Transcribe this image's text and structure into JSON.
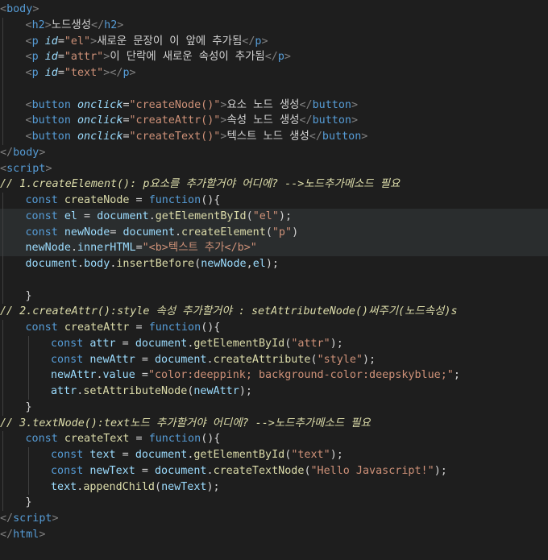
{
  "editor": {
    "lines": [
      {
        "indent": 0,
        "tokens": [
          [
            "br",
            "<"
          ],
          [
            "tag",
            "body"
          ],
          [
            "br",
            ">"
          ]
        ]
      },
      {
        "indent": 1,
        "tokens": [
          [
            "br",
            "<"
          ],
          [
            "tag",
            "h2"
          ],
          [
            "br",
            ">"
          ],
          [
            "t",
            "노드생성"
          ],
          [
            "br",
            "</"
          ],
          [
            "tag",
            "h2"
          ],
          [
            "br",
            ">"
          ]
        ]
      },
      {
        "indent": 1,
        "tokens": [
          [
            "br",
            "<"
          ],
          [
            "tag",
            "p"
          ],
          [
            "t",
            " "
          ],
          [
            "attr",
            "id"
          ],
          [
            "p",
            "="
          ],
          [
            "str",
            "\"el\""
          ],
          [
            "br",
            ">"
          ],
          [
            "t",
            "새로운 문장이 이 앞에 추가됨"
          ],
          [
            "br",
            "</"
          ],
          [
            "tag",
            "p"
          ],
          [
            "br",
            ">"
          ]
        ]
      },
      {
        "indent": 1,
        "tokens": [
          [
            "br",
            "<"
          ],
          [
            "tag",
            "p"
          ],
          [
            "t",
            " "
          ],
          [
            "attr",
            "id"
          ],
          [
            "p",
            "="
          ],
          [
            "str",
            "\"attr\""
          ],
          [
            "br",
            ">"
          ],
          [
            "t",
            "이 단락에 새로운 속성이 추가됨"
          ],
          [
            "br",
            "</"
          ],
          [
            "tag",
            "p"
          ],
          [
            "br",
            ">"
          ]
        ]
      },
      {
        "indent": 1,
        "tokens": [
          [
            "br",
            "<"
          ],
          [
            "tag",
            "p"
          ],
          [
            "t",
            " "
          ],
          [
            "attr",
            "id"
          ],
          [
            "p",
            "="
          ],
          [
            "str",
            "\"text\""
          ],
          [
            "br",
            "></"
          ],
          [
            "tag",
            "p"
          ],
          [
            "br",
            ">"
          ]
        ]
      },
      {
        "indent": 1,
        "tokens": []
      },
      {
        "indent": 1,
        "tokens": [
          [
            "br",
            "<"
          ],
          [
            "tag",
            "button"
          ],
          [
            "t",
            " "
          ],
          [
            "attr",
            "onclick"
          ],
          [
            "p",
            "="
          ],
          [
            "str",
            "\"createNode()\""
          ],
          [
            "br",
            ">"
          ],
          [
            "t",
            "요소 노드 생성"
          ],
          [
            "br",
            "</"
          ],
          [
            "tag",
            "button"
          ],
          [
            "br",
            ">"
          ]
        ]
      },
      {
        "indent": 1,
        "tokens": [
          [
            "br",
            "<"
          ],
          [
            "tag",
            "button"
          ],
          [
            "t",
            " "
          ],
          [
            "attr",
            "onclick"
          ],
          [
            "p",
            "="
          ],
          [
            "str",
            "\"createAttr()\""
          ],
          [
            "br",
            ">"
          ],
          [
            "t",
            "속성 노드 생성"
          ],
          [
            "br",
            "</"
          ],
          [
            "tag",
            "button"
          ],
          [
            "br",
            ">"
          ]
        ]
      },
      {
        "indent": 1,
        "tokens": [
          [
            "br",
            "<"
          ],
          [
            "tag",
            "button"
          ],
          [
            "t",
            " "
          ],
          [
            "attr",
            "onclick"
          ],
          [
            "p",
            "="
          ],
          [
            "str",
            "\"createText()\""
          ],
          [
            "br",
            ">"
          ],
          [
            "t",
            "텍스트 노드 생성"
          ],
          [
            "br",
            "</"
          ],
          [
            "tag",
            "button"
          ],
          [
            "br",
            ">"
          ]
        ]
      },
      {
        "indent": 0,
        "tokens": [
          [
            "br",
            "</"
          ],
          [
            "tag",
            "body"
          ],
          [
            "br",
            ">"
          ]
        ]
      },
      {
        "indent": 0,
        "tokens": [
          [
            "br",
            "<"
          ],
          [
            "tag",
            "script"
          ],
          [
            "br",
            ">"
          ]
        ]
      },
      {
        "indent": 0,
        "tokens": [
          [
            "cm",
            "// 1.createElement(): p요소를 추가할거야 어디에? -->노드추가메소드 필요"
          ]
        ]
      },
      {
        "indent": 1,
        "tokens": [
          [
            "kw",
            "const"
          ],
          [
            "t",
            " "
          ],
          [
            "fn",
            "createNode"
          ],
          [
            "t",
            " = "
          ],
          [
            "kw",
            "function"
          ],
          [
            "t",
            "(){"
          ]
        ]
      },
      {
        "indent": 1,
        "hl": true,
        "dots": "····",
        "tokens": [
          [
            "kw",
            "const"
          ],
          [
            "t",
            " "
          ],
          [
            "var",
            "el"
          ],
          [
            "t",
            " = "
          ],
          [
            "a",
            "document"
          ],
          [
            "t",
            "."
          ],
          [
            "fn",
            "getElementById"
          ],
          [
            "t",
            "("
          ],
          [
            "str",
            "\"el\""
          ],
          [
            "t",
            ");"
          ]
        ]
      },
      {
        "indent": 1,
        "hl": true,
        "tokens": [
          [
            "kw",
            "const"
          ],
          [
            "t",
            " "
          ],
          [
            "var",
            "newNode"
          ],
          [
            "t",
            "= "
          ],
          [
            "a",
            "document"
          ],
          [
            "t",
            "."
          ],
          [
            "fn",
            "createElement"
          ],
          [
            "t",
            "("
          ],
          [
            "str",
            "\"p\""
          ],
          [
            "t",
            ")"
          ]
        ]
      },
      {
        "indent": 1,
        "hl": true,
        "tokens": [
          [
            "a",
            "newNode"
          ],
          [
            "t",
            "."
          ],
          [
            "a",
            "innerHTML"
          ],
          [
            "t",
            "="
          ],
          [
            "str",
            "\"<b>텍스트 추가</b>\""
          ]
        ]
      },
      {
        "indent": 1,
        "tokens": [
          [
            "a",
            "document"
          ],
          [
            "t",
            "."
          ],
          [
            "a",
            "body"
          ],
          [
            "t",
            "."
          ],
          [
            "fn",
            "insertBefore"
          ],
          [
            "t",
            "("
          ],
          [
            "a",
            "newNode"
          ],
          [
            "t",
            ","
          ],
          [
            "a",
            "el"
          ],
          [
            "t",
            ");"
          ]
        ]
      },
      {
        "indent": 1,
        "tokens": []
      },
      {
        "indent": 1,
        "tokens": [
          [
            "t",
            "}"
          ]
        ]
      },
      {
        "indent": 0,
        "tokens": [
          [
            "cm",
            "// 2.createAttr():style 속성 추가할거야 : setAttributeNode()써주기(노드속성)s"
          ]
        ]
      },
      {
        "indent": 1,
        "tokens": [
          [
            "kw",
            "const"
          ],
          [
            "t",
            " "
          ],
          [
            "fn",
            "createAttr"
          ],
          [
            "t",
            " = "
          ],
          [
            "kw",
            "function"
          ],
          [
            "t",
            "(){"
          ]
        ]
      },
      {
        "indent": 2,
        "tokens": [
          [
            "kw",
            "const"
          ],
          [
            "t",
            " "
          ],
          [
            "var",
            "attr"
          ],
          [
            "t",
            " = "
          ],
          [
            "a",
            "document"
          ],
          [
            "t",
            "."
          ],
          [
            "fn",
            "getElementById"
          ],
          [
            "t",
            "("
          ],
          [
            "str",
            "\"attr\""
          ],
          [
            "t",
            ");"
          ]
        ]
      },
      {
        "indent": 2,
        "tokens": [
          [
            "kw",
            "const"
          ],
          [
            "t",
            " "
          ],
          [
            "var",
            "newAttr"
          ],
          [
            "t",
            " = "
          ],
          [
            "a",
            "document"
          ],
          [
            "t",
            "."
          ],
          [
            "fn",
            "createAttribute"
          ],
          [
            "t",
            "("
          ],
          [
            "str",
            "\"style\""
          ],
          [
            "t",
            ");"
          ]
        ]
      },
      {
        "indent": 2,
        "tokens": [
          [
            "a",
            "newAttr"
          ],
          [
            "t",
            "."
          ],
          [
            "a",
            "value"
          ],
          [
            "t",
            " ="
          ],
          [
            "str",
            "\"color:deeppink; background-color:deepskyblue;\""
          ],
          [
            "t",
            ";"
          ]
        ]
      },
      {
        "indent": 2,
        "tokens": [
          [
            "a",
            "attr"
          ],
          [
            "t",
            "."
          ],
          [
            "fn",
            "setAttributeNode"
          ],
          [
            "t",
            "("
          ],
          [
            "a",
            "newAttr"
          ],
          [
            "t",
            ");"
          ]
        ]
      },
      {
        "indent": 1,
        "tokens": [
          [
            "t",
            "}"
          ]
        ]
      },
      {
        "indent": 0,
        "tokens": [
          [
            "cm",
            "// 3.textNode():text노드 추가할거야 어디에? -->노드추가메소드 필요"
          ]
        ]
      },
      {
        "indent": 1,
        "tokens": [
          [
            "kw",
            "const"
          ],
          [
            "t",
            " "
          ],
          [
            "fn",
            "createText"
          ],
          [
            "t",
            " = "
          ],
          [
            "kw",
            "function"
          ],
          [
            "t",
            "(){"
          ]
        ]
      },
      {
        "indent": 2,
        "tokens": [
          [
            "kw",
            "const"
          ],
          [
            "t",
            " "
          ],
          [
            "var",
            "text"
          ],
          [
            "t",
            " = "
          ],
          [
            "a",
            "document"
          ],
          [
            "t",
            "."
          ],
          [
            "fn",
            "getElementById"
          ],
          [
            "t",
            "("
          ],
          [
            "str",
            "\"text\""
          ],
          [
            "t",
            ");"
          ]
        ]
      },
      {
        "indent": 2,
        "tokens": [
          [
            "kw",
            "const"
          ],
          [
            "t",
            " "
          ],
          [
            "var",
            "newText"
          ],
          [
            "t",
            " = "
          ],
          [
            "a",
            "document"
          ],
          [
            "t",
            "."
          ],
          [
            "fn",
            "createTextNode"
          ],
          [
            "t",
            "("
          ],
          [
            "str",
            "\"Hello Javascript!\""
          ],
          [
            "t",
            ");"
          ]
        ]
      },
      {
        "indent": 2,
        "tokens": [
          [
            "a",
            "text"
          ],
          [
            "t",
            "."
          ],
          [
            "fn",
            "appendChild"
          ],
          [
            "t",
            "("
          ],
          [
            "a",
            "newText"
          ],
          [
            "t",
            ");"
          ]
        ]
      },
      {
        "indent": 1,
        "tokens": [
          [
            "t",
            "}"
          ]
        ]
      },
      {
        "indent": 0,
        "tokens": [
          [
            "br",
            "</"
          ],
          [
            "tag",
            "script"
          ],
          [
            "br",
            ">"
          ]
        ]
      },
      {
        "indent": 0,
        "tokens": [
          [
            "br",
            "</"
          ],
          [
            "tag",
            "html"
          ],
          [
            "br",
            ">"
          ]
        ]
      }
    ]
  }
}
